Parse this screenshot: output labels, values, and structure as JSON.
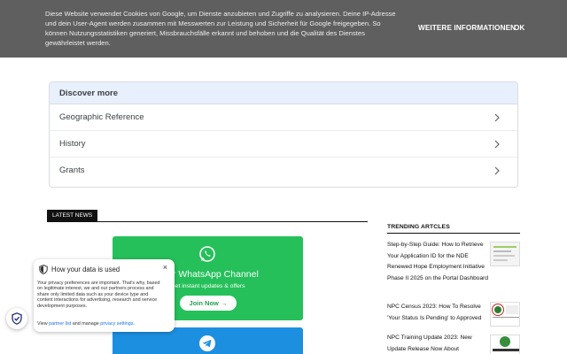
{
  "cookie": {
    "text": "Diese Website verwendet Cookies von Google, um Dienste anzubieten und Zugriffe zu analysieren. Deine IP-Adresse und dein User-Agent werden zusammen mit Messwerten zur Leistung und Sicherheit für Google freigegeben. So können Nutzungsstatistiken generiert, Missbrauchsfälle erkannt und behoben und die Qualität des Dienstes gewährleistet werden.",
    "more_label": "WEITERE INFORMATIONEN",
    "ok_label": "OK"
  },
  "discover": {
    "title": "Discover more",
    "items": [
      {
        "label": "Geographic Reference"
      },
      {
        "label": "History"
      },
      {
        "label": "Grants"
      }
    ]
  },
  "latest": {
    "tag": "LATEST NEWS"
  },
  "whatsapp": {
    "title": "Your WhatsApp Channel",
    "subtitle": "Get instant updates & offers",
    "button": "Join Now →"
  },
  "privacy": {
    "title": "How your data is used",
    "close": "×",
    "body": "Your privacy preferences are important. That's why, based on legitimate interest, we and our partners process and share only limited data such as your device type and content interactions for advertising, research and service development purposes.",
    "foot_prefix": "View ",
    "partner_link": "partner list",
    "foot_mid": " and manage ",
    "pref_link": "privacy settings",
    "foot_suffix": "."
  },
  "trending": {
    "title": "TRENDING ARTCLES",
    "items": [
      {
        "title": "Step-by-Step Guide: How to Retrieve Your Application ID for the NDE Renewed Hope Employment Initiative Phase II 2025 on the Portal Dashboard"
      },
      {
        "title": "NPC Census 2023: How To Resolve 'Your Status Is Pending' to Approved"
      },
      {
        "title": "NPC Training Update 2023: New Update Release Now About"
      }
    ]
  },
  "colors": {
    "cookie_bg": "#5f5f5f",
    "discover_head": "#e8f0fe",
    "whatsapp": "#25c05a",
    "telegram": "#1d8fe0"
  }
}
